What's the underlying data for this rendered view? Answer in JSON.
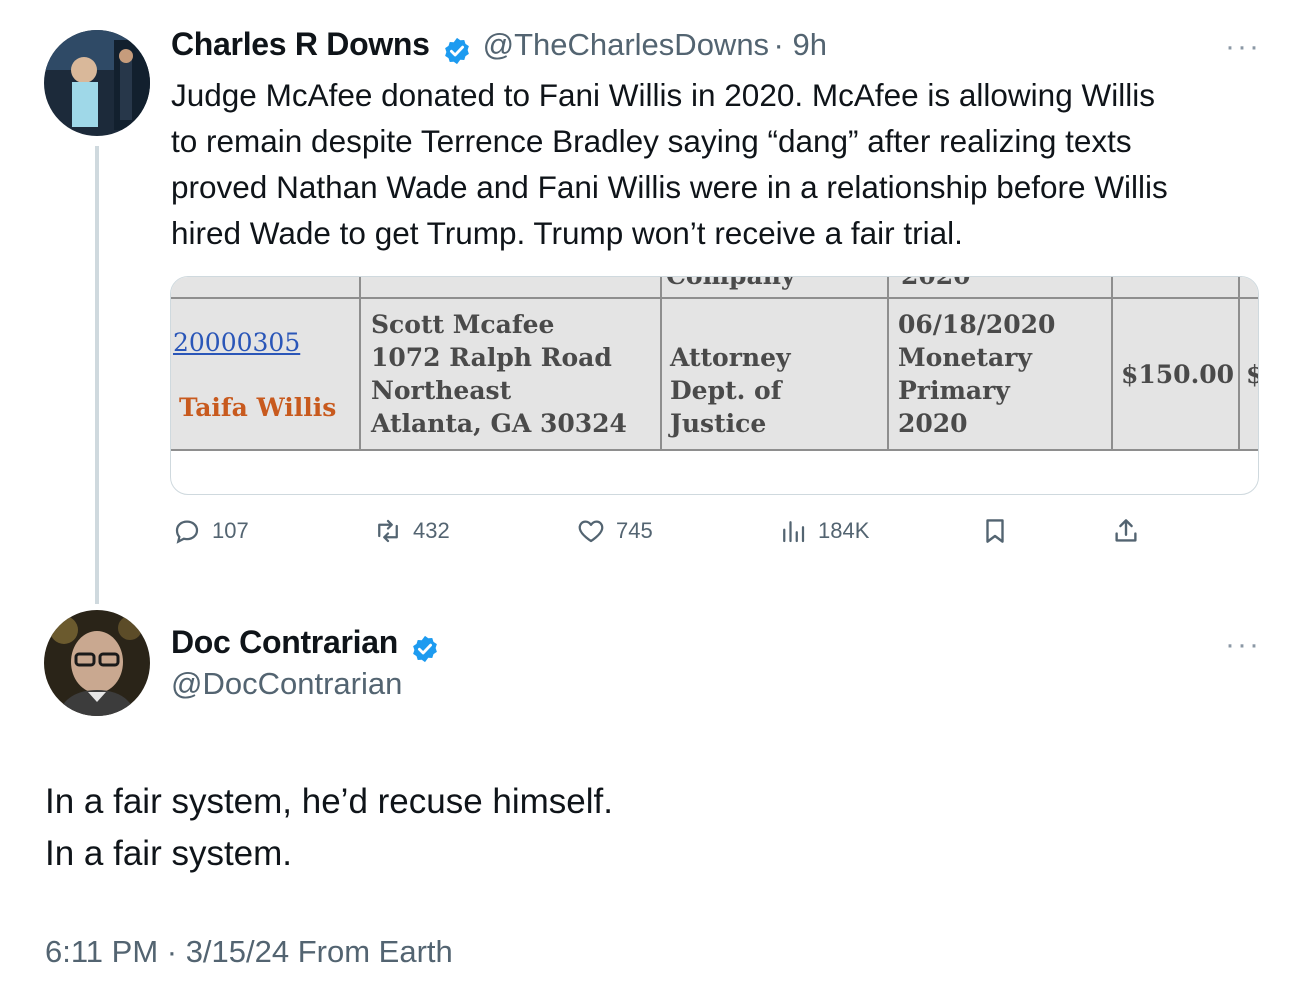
{
  "tweet1": {
    "author_name": "Charles R Downs",
    "handle": "@TheCharlesDowns",
    "time": "· 9h",
    "more": "···",
    "text_lines": [
      "Judge McAfee donated to Fani Willis in 2020. McAfee is allowing Willis",
      "to remain despite Terrence Bradley saying “dang” after realizing texts",
      "proved Nathan Wade and Fani Willis were in a relationship before Willis",
      "hired Wade to get Trump. Trump won’t receive a fair trial."
    ],
    "media": {
      "top_cut_1": "Company",
      "top_cut_2": "2020",
      "record_id": "20000305",
      "recipient": "Taifa Willis",
      "donor_lines": [
        "Scott Mcafee",
        "1072 Ralph Road",
        "Northeast",
        "Atlanta, GA 30324"
      ],
      "employer_lines": [
        "Attorney",
        "Dept. of",
        "Justice"
      ],
      "date_lines": [
        "06/18/2020",
        "Monetary",
        "Primary",
        "2020"
      ],
      "amount": "$150.00",
      "amount_cut": "$"
    },
    "actions": {
      "replies": "107",
      "reposts": "432",
      "likes": "745",
      "views": "184K"
    }
  },
  "tweet2": {
    "author_name": "Doc Contrarian",
    "handle": "@DocContrarian",
    "more": "···",
    "text_lines": [
      "In a fair system, he’d recuse himself.",
      "In a fair system."
    ],
    "timestamp": "6:11 PM · 3/15/24 From Earth"
  },
  "colors": {
    "verified_blue": "#1d9bf0",
    "secondary_text": "#536471",
    "link_blue": "#2a56b8",
    "recipient_orange": "#c85a1e"
  },
  "icons": {
    "reply": "reply-icon",
    "repost": "repost-icon",
    "like": "heart-icon",
    "views": "bar-chart-icon",
    "bookmark": "bookmark-icon",
    "share": "share-icon"
  }
}
